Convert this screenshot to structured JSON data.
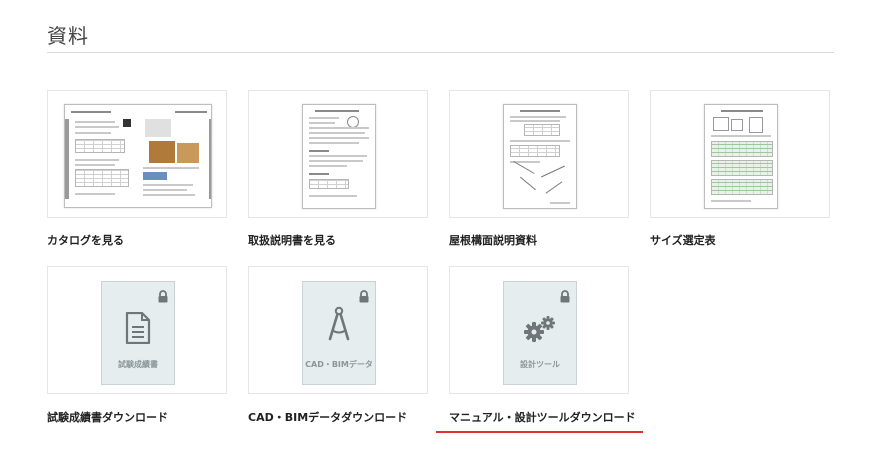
{
  "section": {
    "title": "資料"
  },
  "items": [
    {
      "label": "カタログを見る"
    },
    {
      "label": "取扱説明書を見る"
    },
    {
      "label": "屋根構面説明資料"
    },
    {
      "label": "サイズ選定表"
    },
    {
      "label": "試験成績書ダウンロード",
      "placeholder": "試験成績書",
      "icon": "document-icon",
      "locked": true
    },
    {
      "label": "CAD・BIMデータダウンロード",
      "placeholder": "CAD・BIMデータ",
      "icon": "drafting-compass-icon",
      "locked": true
    },
    {
      "label": "マニュアル・設計ツールダウンロード",
      "placeholder": "設計ツール",
      "icon": "gears-icon",
      "locked": true,
      "active": true
    }
  ],
  "colors": {
    "accent_underline": "#e03131",
    "placeholder_bg": "#e6edee",
    "icon_gray": "#6f7579"
  }
}
